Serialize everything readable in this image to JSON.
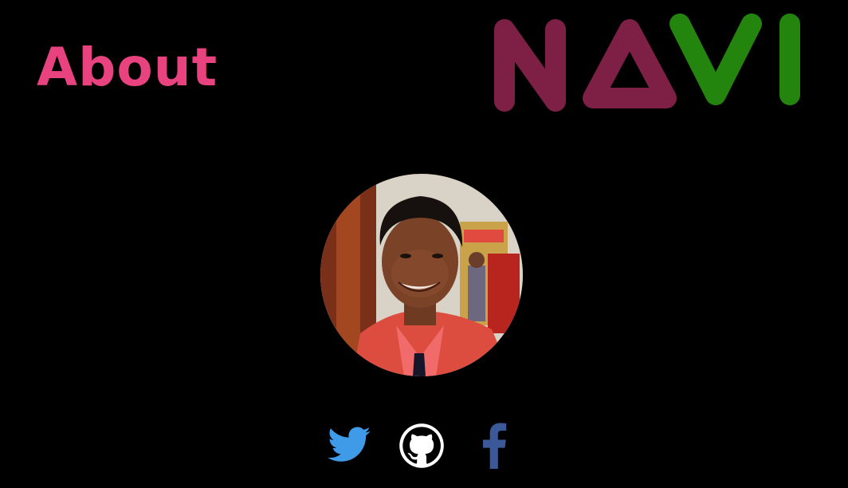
{
  "header": {
    "title": "About",
    "title_color": "#e9437f"
  },
  "logo": {
    "text": "NAVI",
    "letters": [
      "N",
      "A",
      "V",
      "I"
    ],
    "color_primary": "#7e1f46",
    "color_secondary": "#23840e"
  },
  "profile": {
    "avatar_icon": "profile-photo"
  },
  "social": {
    "items": [
      {
        "name": "twitter",
        "icon": "twitter-icon",
        "color": "#3f9be8"
      },
      {
        "name": "github",
        "icon": "github-icon",
        "color": "#ffffff"
      },
      {
        "name": "facebook",
        "icon": "facebook-icon",
        "color": "#3b5998"
      }
    ]
  }
}
